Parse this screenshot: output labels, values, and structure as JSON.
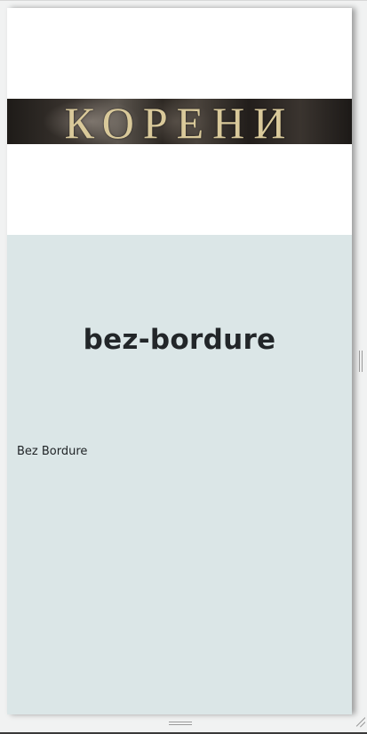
{
  "banner": {
    "title": "КОРЕНИ"
  },
  "page": {
    "title": "bez-bordure",
    "text": "Bez Bordure"
  },
  "colors": {
    "content_background": "#dbe6e7",
    "banner_text": "#d9c99a",
    "title_text": "#222629"
  },
  "icons": {
    "right_handle": "vertical-resize-grip-icon",
    "bottom_handle": "horizontal-resize-grip-icon",
    "corner_handle": "resize-corner-icon"
  }
}
